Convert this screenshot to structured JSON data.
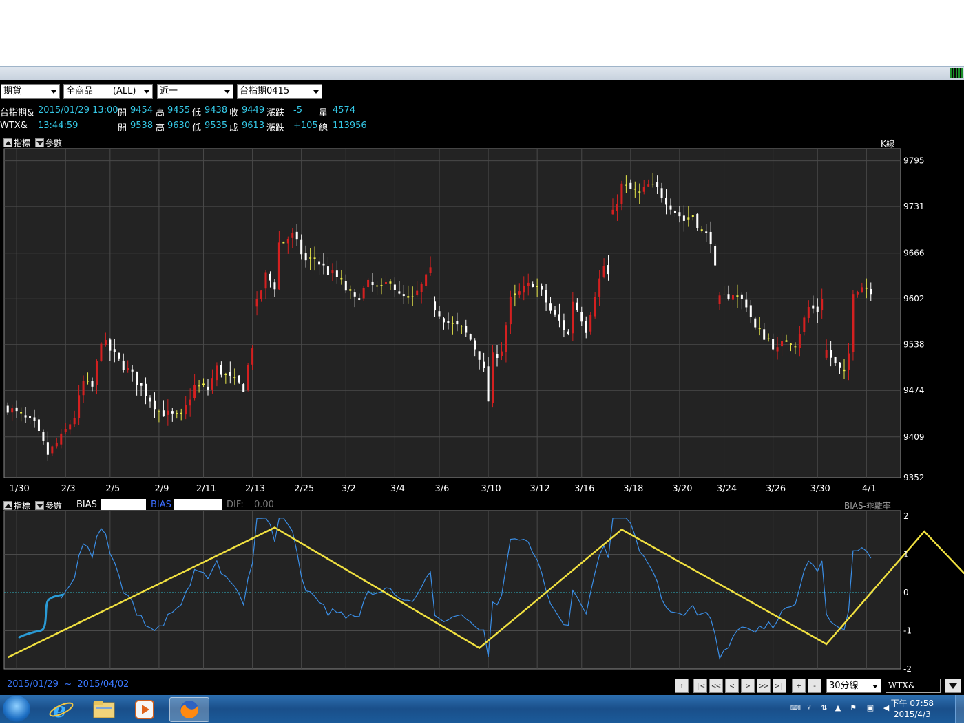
{
  "toolbar": {
    "market": "期貨",
    "products": "全商品       (ALL)",
    "period": "近一",
    "contract": "台指期0415"
  },
  "quote1": {
    "name": "台指期&",
    "datetime": "2015/01/29 13:00",
    "open_label": "開",
    "open": "9454",
    "high_label": "高",
    "high": "9455",
    "low_label": "低",
    "low": "9438",
    "close_label": "收",
    "close": "9449",
    "change_label": "漲跌",
    "change": "-5",
    "volume_label": "量",
    "volume": "4574"
  },
  "quote2": {
    "name": "WTX&",
    "time": "13:44:59",
    "open_label": "開",
    "open": "9538",
    "high_label": "高",
    "high": "9630",
    "low_label": "低",
    "low": "9535",
    "close_label": "成",
    "close": "9613",
    "change_label": "漲跌",
    "change": "+105",
    "total_label": "總",
    "total": "113956"
  },
  "main_panel": {
    "indicator_btn": "指標",
    "param_btn": "參數",
    "kline_label": "K線"
  },
  "bias_panel": {
    "indicator_btn": "指標",
    "param_btn": "參數",
    "bias_label1": "BIAS",
    "bias_label2": "BIAS",
    "dif_label": "DIF:",
    "dif_value": "0.00",
    "title": "BIAS-乖離率"
  },
  "chart_data": [
    {
      "type": "candlestick",
      "title": "K線",
      "x_ticks": [
        "1/30",
        "2/3",
        "2/5",
        "2/9",
        "2/11",
        "2/13",
        "2/25",
        "3/2",
        "3/4",
        "3/6",
        "3/10",
        "3/12",
        "3/16",
        "3/18",
        "3/20",
        "3/24",
        "3/26",
        "3/30",
        "4/1"
      ],
      "y_ticks": [
        9795,
        9731,
        9666,
        9602,
        9538,
        9474,
        9409,
        9352
      ],
      "ylim": [
        9352,
        9812
      ],
      "grid": true,
      "colors": {
        "up": "#d42020",
        "down": "#ffffff",
        "flat": "#e8e84a",
        "background": "#232323",
        "grid": "#4a4a4a"
      },
      "close_path": [
        [
          0,
          9450
        ],
        [
          6,
          9425
        ],
        [
          9,
          9385
        ],
        [
          12,
          9408
        ],
        [
          15,
          9438
        ],
        [
          17,
          9485
        ],
        [
          19,
          9478
        ],
        [
          21,
          9545
        ],
        [
          25,
          9515
        ],
        [
          28,
          9495
        ],
        [
          31,
          9470
        ],
        [
          34,
          9445
        ],
        [
          37,
          9438
        ],
        [
          39,
          9436
        ],
        [
          42,
          9480
        ],
        [
          45,
          9476
        ],
        [
          47,
          9505
        ],
        [
          50,
          9490
        ],
        [
          53,
          9478
        ],
        [
          55,
          9537
        ],
        [
          56,
          9595
        ],
        [
          58,
          9635
        ],
        [
          60,
          9620
        ],
        [
          61,
          9680
        ],
        [
          64,
          9690
        ],
        [
          67,
          9655
        ],
        [
          69,
          9658
        ],
        [
          72,
          9640
        ],
        [
          74,
          9632
        ],
        [
          76,
          9615
        ],
        [
          78,
          9600
        ],
        [
          81,
          9622
        ],
        [
          84,
          9615
        ],
        [
          86,
          9630
        ],
        [
          88,
          9605
        ],
        [
          91,
          9600
        ],
        [
          93,
          9620
        ],
        [
          95,
          9640
        ],
        [
          96,
          9590
        ],
        [
          99,
          9568
        ],
        [
          102,
          9560
        ],
        [
          104,
          9545
        ],
        [
          106,
          9522
        ],
        [
          107,
          9500
        ],
        [
          108,
          9460
        ],
        [
          109,
          9520
        ],
        [
          111,
          9532
        ],
        [
          113,
          9600
        ],
        [
          116,
          9615
        ],
        [
          118,
          9625
        ],
        [
          120,
          9610
        ],
        [
          122,
          9585
        ],
        [
          124,
          9570
        ],
        [
          126,
          9552
        ],
        [
          127,
          9600
        ],
        [
          129,
          9575
        ],
        [
          130,
          9560
        ],
        [
          132,
          9610
        ],
        [
          134,
          9648
        ],
        [
          135,
          9635
        ],
        [
          136,
          9720
        ],
        [
          138,
          9760
        ],
        [
          140,
          9755
        ],
        [
          142,
          9748
        ],
        [
          144,
          9760
        ],
        [
          146,
          9755
        ],
        [
          148,
          9740
        ],
        [
          150,
          9725
        ],
        [
          152,
          9712
        ],
        [
          154,
          9720
        ],
        [
          156,
          9695
        ],
        [
          158,
          9685
        ],
        [
          160,
          9600
        ],
        [
          163,
          9610
        ],
        [
          166,
          9595
        ],
        [
          168,
          9560
        ],
        [
          171,
          9545
        ],
        [
          173,
          9530
        ],
        [
          175,
          9545
        ],
        [
          177,
          9540
        ],
        [
          180,
          9590
        ],
        [
          182,
          9585
        ],
        [
          183,
          9605
        ],
        [
          184,
          9530
        ],
        [
          186,
          9510
        ],
        [
          188,
          9495
        ],
        [
          189,
          9525
        ],
        [
          190,
          9615
        ],
        [
          192,
          9620
        ],
        [
          194,
          9615
        ]
      ],
      "n_bars": 195
    },
    {
      "type": "line",
      "title": "BIAS-乖離率",
      "y_ticks": [
        2,
        1,
        0,
        -1,
        -2
      ],
      "ylim": [
        -2,
        2
      ],
      "zero_line": true,
      "colors": {
        "bias": "#3a8ee6",
        "annotation": "#f0e040"
      },
      "annotation_lines": [
        [
          [
            0.0,
            -1.7
          ],
          [
            60.0,
            1.7
          ],
          [
            106.0,
            -1.45
          ],
          [
            138.0,
            1.65
          ],
          [
            184.0,
            -1.35
          ],
          [
            206.0,
            1.6
          ],
          [
            215.0,
            0.5
          ]
        ]
      ]
    }
  ],
  "bottom": {
    "date_from": "2015/01/29",
    "tilde": "~",
    "date_to": "2015/04/02",
    "nav": [
      "↑",
      "|<",
      "<<",
      "<",
      ">",
      ">>",
      ">|",
      "+",
      "-"
    ],
    "interval": "30分線",
    "symbol": "WTX&"
  },
  "taskbar": {
    "time": "下午 07:58",
    "date": "2015/4/3"
  }
}
